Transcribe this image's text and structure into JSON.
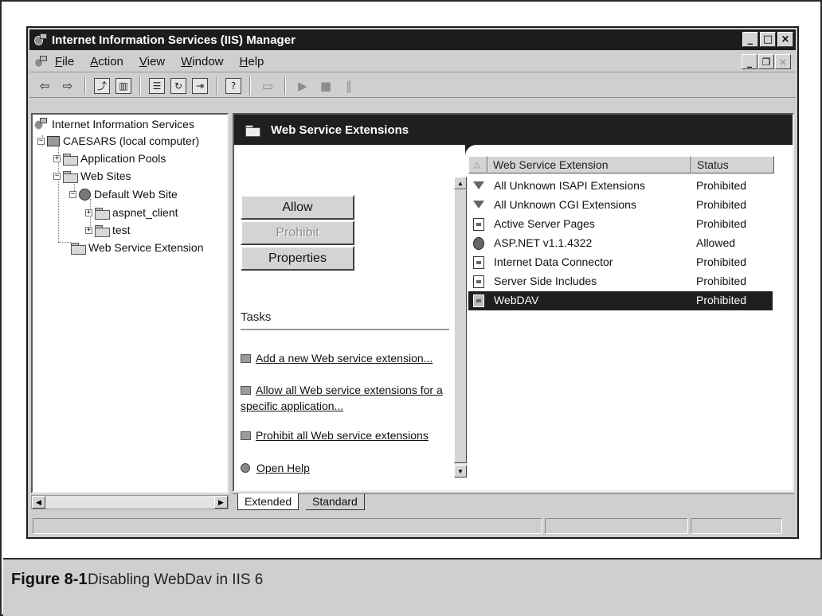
{
  "window": {
    "title": "Internet Information Services (IIS) Manager",
    "buttons": [
      "_",
      "□",
      "×"
    ]
  },
  "menu": {
    "items": [
      {
        "label": "File",
        "accel": "F",
        "rest": "ile"
      },
      {
        "label": "Action",
        "accel": "A",
        "rest": "ction"
      },
      {
        "label": "View",
        "accel": "V",
        "rest": "iew"
      },
      {
        "label": "Window",
        "accel": "W",
        "rest": "indow"
      },
      {
        "label": "Help",
        "accel": "H",
        "rest": "elp"
      }
    ],
    "mdi_buttons": [
      "_",
      "ð",
      "×"
    ]
  },
  "toolbar": {
    "buttons": [
      {
        "name": "back",
        "glyph": "⇦"
      },
      {
        "name": "forward",
        "glyph": "⇨"
      },
      {
        "name": "up-one-level",
        "glyph": "⤴"
      },
      {
        "name": "show-hide-tree",
        "glyph": "▥"
      },
      {
        "name": "properties",
        "glyph": "☰"
      },
      {
        "name": "refresh",
        "glyph": "↻"
      },
      {
        "name": "export-list",
        "glyph": "⇥"
      },
      {
        "name": "help",
        "glyph": "?"
      },
      {
        "name": "computer",
        "glyph": "▭"
      },
      {
        "name": "start",
        "glyph": "▶"
      },
      {
        "name": "stop",
        "glyph": "■"
      },
      {
        "name": "pause",
        "glyph": "‖"
      }
    ]
  },
  "tree": {
    "root": "Internet Information Services",
    "computer": "CAESARS (local computer)",
    "app_pools": "Application Pools",
    "web_sites": "Web Sites",
    "default_site": "Default Web Site",
    "aspnet_client": "aspnet_client",
    "test": "test",
    "web_service_ext": "Web Service Extension"
  },
  "panel": {
    "title": "Web Service Extensions",
    "buttons": {
      "allow": "Allow",
      "prohibit": "Prohibit",
      "properties": "Properties"
    },
    "tasks_label": "Tasks",
    "tasks": [
      "Add a new Web service extension...",
      "Allow all Web service extensions for a specific application...",
      "Prohibit all Web service extensions",
      "Open Help"
    ]
  },
  "list": {
    "columns": [
      "Web Service Extension",
      "Status"
    ],
    "rows": [
      {
        "name": "All Unknown ISAPI Extensions",
        "status": "Prohibited",
        "icon": "filter-icon"
      },
      {
        "name": "All Unknown CGI Extensions",
        "status": "Prohibited",
        "icon": "filter-icon"
      },
      {
        "name": "Active Server Pages",
        "status": "Prohibited",
        "icon": "page-icon"
      },
      {
        "name": "ASP.NET v1.1.4322",
        "status": "Allowed",
        "icon": "aspnet-icon"
      },
      {
        "name": "Internet Data Connector",
        "status": "Prohibited",
        "icon": "page-icon"
      },
      {
        "name": "Server Side Includes",
        "status": "Prohibited",
        "icon": "page-icon"
      },
      {
        "name": "WebDAV",
        "status": "Prohibited",
        "icon": "page-icon",
        "selected": true
      }
    ]
  },
  "tabs": {
    "extended": "Extended",
    "standard": "Standard"
  },
  "caption": {
    "figure": "Figure 8-1",
    "text": "Disabling WebDav in IIS 6"
  }
}
